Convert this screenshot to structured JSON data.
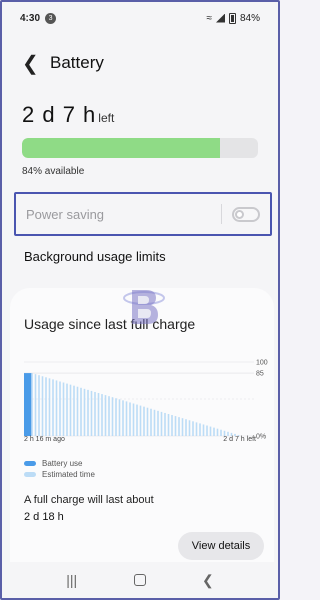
{
  "status_bar": {
    "time": "4:30",
    "notification_count": "3",
    "battery_percent": "84%"
  },
  "header": {
    "title": "Battery"
  },
  "summary": {
    "remaining_value": "2 d 7 h",
    "remaining_suffix": "left",
    "available_text": "84% available",
    "level_fraction": 0.84
  },
  "power_saving": {
    "label": "Power saving",
    "enabled": false
  },
  "background_usage": {
    "label": "Background usage limits"
  },
  "usage": {
    "title": "Usage since last full charge",
    "x_start_label": "2 h 16 m ago",
    "x_end_label": "2 d 7 h left",
    "legend": [
      {
        "label": "Battery use",
        "color": "#4a9be8"
      },
      {
        "label": "Estimated time",
        "color": "#bcdcf6"
      }
    ],
    "full_charge_label": "A full charge will last about",
    "full_charge_value": "2 d 18 h",
    "details_button": "View details"
  },
  "chart_data": {
    "type": "area",
    "y_ticks": [
      "100",
      "85",
      "0%"
    ],
    "ylim": [
      0,
      100
    ],
    "series": [
      {
        "name": "Battery use",
        "values": [
          100,
          85
        ]
      },
      {
        "name": "Estimated time",
        "values": [
          85,
          0
        ]
      }
    ],
    "x_labels": [
      "2 h 16 m ago",
      "2 d 7 h left"
    ],
    "colors": {
      "battery_use": "#4a9be8",
      "estimated": "#bcdcf6"
    }
  },
  "colors": {
    "battery_fill": "#8fdb86",
    "highlight_border": "#4a55b0"
  }
}
